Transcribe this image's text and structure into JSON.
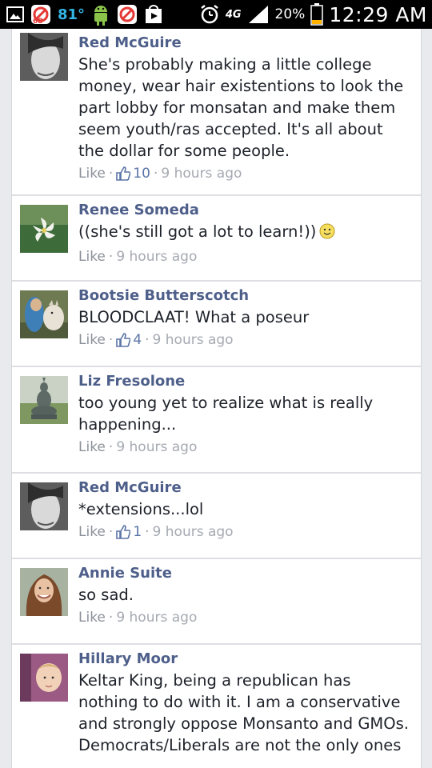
{
  "status_bar": {
    "temperature": "81°",
    "network": "4G",
    "battery": "20%",
    "time": "12:29 AM",
    "icons": [
      "gallery-icon",
      "notification-badge-icon",
      "android-icon",
      "notification-badge-icon",
      "play-store-icon",
      "alarm-icon",
      "signal-icon",
      "battery-icon"
    ]
  },
  "comments": [
    {
      "name": "Red McGuire",
      "text": "She's probably making a little college money, wear hair existentions to look the part lobby for monsatan and make them seem youth/ras accepted. It's all about the dollar for some people.",
      "like_label": "Like",
      "likes": "10",
      "time": "9 hours ago",
      "avatar": "woman-grayscale-avatar"
    },
    {
      "name": "Renee Someda",
      "text": "((she's still got a lot to learn!))",
      "emoji": "smiley-icon",
      "like_label": "Like",
      "likes": null,
      "time": "9 hours ago",
      "avatar": "white-flower-avatar"
    },
    {
      "name": "Bootsie Butterscotch",
      "text": "BLOODCLAAT! What a poseur",
      "like_label": "Like",
      "likes": "4",
      "time": "9 hours ago",
      "avatar": "woman-with-goat-avatar"
    },
    {
      "name": "Liz Fresolone",
      "text": "too young yet to realize what is really happening...",
      "like_label": "Like",
      "likes": null,
      "time": "9 hours ago",
      "avatar": "buddha-statue-avatar"
    },
    {
      "name": "Red McGuire",
      "text": "*extensions...lol",
      "like_label": "Like",
      "likes": "1",
      "time": "9 hours ago",
      "avatar": "woman-grayscale-avatar"
    },
    {
      "name": "Annie Suite",
      "text": "so sad.",
      "like_label": "Like",
      "likes": null,
      "time": "9 hours ago",
      "avatar": "woman-smiling-avatar"
    },
    {
      "name": "Hillary Moor",
      "text": "Keltar King, being a republican has nothing to do with it. I am a conservative and strongly oppose Monsanto and GMOs. Democrats/Liberals are not the only ones",
      "like_label": null,
      "likes": null,
      "time": null,
      "avatar": "child-avatar"
    }
  ],
  "colors": {
    "name": "#4e5f8a",
    "text": "#1d2129",
    "meta": "#8c909a",
    "like_count": "#5a74a6",
    "background": "#e9eaed",
    "status_bar_accent": "#33b5e5"
  }
}
